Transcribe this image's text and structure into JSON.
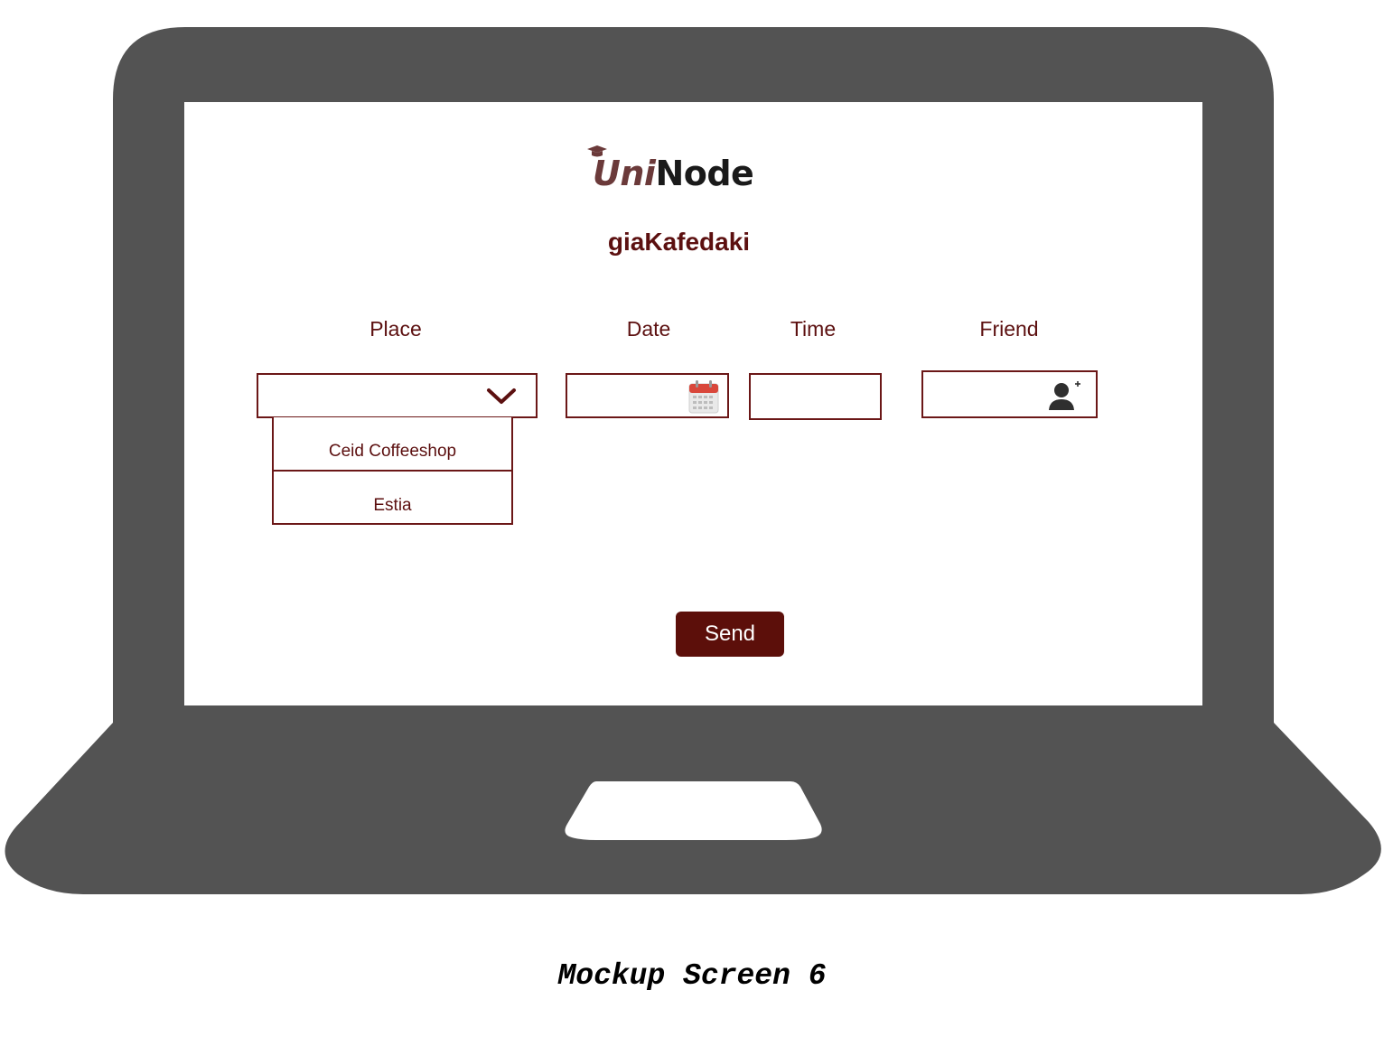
{
  "colors": {
    "laptop_body": "#535353",
    "accent": "#5c1010",
    "button_bg": "#5c0f0a",
    "button_text": "#ffffff"
  },
  "app": {
    "logo_part1": "Uni",
    "logo_part2": "Node",
    "title": "giaKafedaki"
  },
  "form": {
    "place_label": "Place",
    "date_label": "Date",
    "time_label": "Time",
    "friend_label": "Friend",
    "place_value": "",
    "date_value": "",
    "time_value": "",
    "friend_value": "",
    "place_options": [
      "Ceid Coffeeshop",
      "Estia"
    ],
    "send_label": "Send"
  },
  "icons": {
    "logo": "graduation-cap-icon",
    "place_toggle": "chevron-down-icon",
    "date_picker": "calendar-icon",
    "friend_add": "add-user-icon"
  },
  "caption": "Mockup Screen 6"
}
